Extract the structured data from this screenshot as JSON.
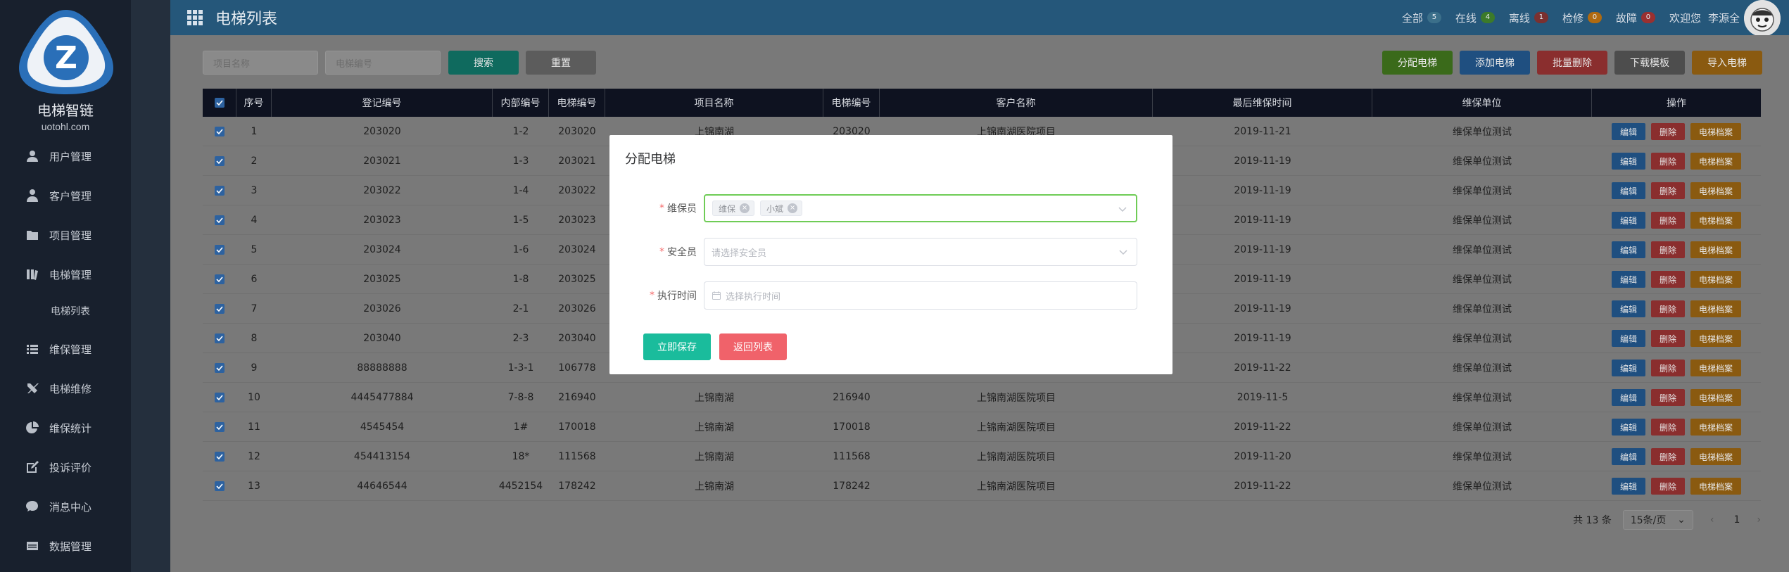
{
  "brand": {
    "name": "电梯智链",
    "url": "uotohl.com",
    "logo_letter": "Z"
  },
  "sidebar": {
    "items": [
      {
        "label": "用户管理",
        "icon": "user-icon"
      },
      {
        "label": "客户管理",
        "icon": "customer-icon"
      },
      {
        "label": "项目管理",
        "icon": "folder-icon"
      },
      {
        "label": "电梯管理",
        "icon": "elevator-icon"
      },
      {
        "label": "维保管理",
        "icon": "list-icon"
      },
      {
        "label": "电梯维修",
        "icon": "tools-icon"
      },
      {
        "label": "维保统计",
        "icon": "pie-chart-icon"
      },
      {
        "label": "投诉评价",
        "icon": "edit-icon"
      },
      {
        "label": "消息中心",
        "icon": "message-icon"
      },
      {
        "label": "数据管理",
        "icon": "data-icon"
      }
    ],
    "subitem": "电梯列表"
  },
  "header": {
    "title": "电梯列表",
    "status": [
      {
        "label": "全部",
        "count": "5",
        "color": "#3b6f8a"
      },
      {
        "label": "在线",
        "count": "4",
        "color": "#3c7a2a"
      },
      {
        "label": "离线",
        "count": "1",
        "color": "#7a3030"
      },
      {
        "label": "检修",
        "count": "0",
        "color": "#b06a10"
      },
      {
        "label": "故障",
        "count": "0",
        "color": "#9a3030"
      }
    ],
    "welcome": "欢迎您",
    "username": "李源全"
  },
  "filters": {
    "project_placeholder": "项目名称",
    "elevator_placeholder": "电梯编号",
    "search_label": "搜索",
    "reset_label": "重置"
  },
  "actions": {
    "assign": "分配电梯",
    "add": "添加电梯",
    "batch_delete": "批量删除",
    "download": "下载模板",
    "import": "导入电梯"
  },
  "table": {
    "headers": [
      "序号",
      "登记编号",
      "内部编号",
      "电梯编号",
      "项目名称",
      "电梯编号",
      "客户名称",
      "最后维保时间",
      "维保单位",
      "操作"
    ],
    "ops": {
      "edit": "编辑",
      "delete": "删除",
      "archive": "电梯档案"
    },
    "rows": [
      {
        "no": "1",
        "reg": "203020",
        "inner": "1-2",
        "elev": "203020",
        "project": "上锦南湖",
        "elev2": "203020",
        "customer": "上锦南湖医院项目",
        "last": "2019-11-21",
        "unit": "维保单位测试"
      },
      {
        "no": "2",
        "reg": "203021",
        "inner": "1-3",
        "elev": "203021",
        "project": "",
        "elev2": "",
        "customer": "",
        "last": "2019-11-19",
        "unit": "维保单位测试"
      },
      {
        "no": "3",
        "reg": "203022",
        "inner": "1-4",
        "elev": "203022",
        "project": "",
        "elev2": "",
        "customer": "",
        "last": "2019-11-19",
        "unit": "维保单位测试"
      },
      {
        "no": "4",
        "reg": "203023",
        "inner": "1-5",
        "elev": "203023",
        "project": "",
        "elev2": "",
        "customer": "",
        "last": "2019-11-19",
        "unit": "维保单位测试"
      },
      {
        "no": "5",
        "reg": "203024",
        "inner": "1-6",
        "elev": "203024",
        "project": "",
        "elev2": "",
        "customer": "",
        "last": "2019-11-19",
        "unit": "维保单位测试"
      },
      {
        "no": "6",
        "reg": "203025",
        "inner": "1-8",
        "elev": "203025",
        "project": "",
        "elev2": "",
        "customer": "",
        "last": "2019-11-19",
        "unit": "维保单位测试"
      },
      {
        "no": "7",
        "reg": "203026",
        "inner": "2-1",
        "elev": "203026",
        "project": "",
        "elev2": "",
        "customer": "",
        "last": "2019-11-19",
        "unit": "维保单位测试"
      },
      {
        "no": "8",
        "reg": "203040",
        "inner": "2-3",
        "elev": "203040",
        "project": "",
        "elev2": "",
        "customer": "",
        "last": "2019-11-19",
        "unit": "维保单位测试"
      },
      {
        "no": "9",
        "reg": "88888888",
        "inner": "1-3-1",
        "elev": "106778",
        "project": "",
        "elev2": "",
        "customer": "",
        "last": "2019-11-22",
        "unit": "维保单位测试"
      },
      {
        "no": "10",
        "reg": "4445477884",
        "inner": "7-8-8",
        "elev": "216940",
        "project": "上锦南湖",
        "elev2": "216940",
        "customer": "上锦南湖医院项目",
        "last": "2019-11-5",
        "unit": "维保单位测试"
      },
      {
        "no": "11",
        "reg": "4545454",
        "inner": "1#",
        "elev": "170018",
        "project": "上锦南湖",
        "elev2": "170018",
        "customer": "上锦南湖医院项目",
        "last": "2019-11-22",
        "unit": "维保单位测试"
      },
      {
        "no": "12",
        "reg": "454413154",
        "inner": "18*",
        "elev": "111568",
        "project": "上锦南湖",
        "elev2": "111568",
        "customer": "上锦南湖医院项目",
        "last": "2019-11-20",
        "unit": "维保单位测试"
      },
      {
        "no": "13",
        "reg": "44646544",
        "inner": "4452154",
        "elev": "178242",
        "project": "上锦南湖",
        "elev2": "178242",
        "customer": "上锦南湖医院项目",
        "last": "2019-11-22",
        "unit": "维保单位测试"
      }
    ]
  },
  "pagination": {
    "total": "共 13 条",
    "page_size": "15条/页",
    "page": "1"
  },
  "modal": {
    "title": "分配电梯",
    "fields": {
      "maintainer_label": "维保员",
      "maintainer_tags": [
        "维保",
        "小斌"
      ],
      "safety_label": "安全员",
      "safety_placeholder": "请选择安全员",
      "time_label": "执行时间",
      "time_placeholder": "选择执行时间"
    },
    "save_label": "立即保存",
    "back_label": "返回列表"
  }
}
